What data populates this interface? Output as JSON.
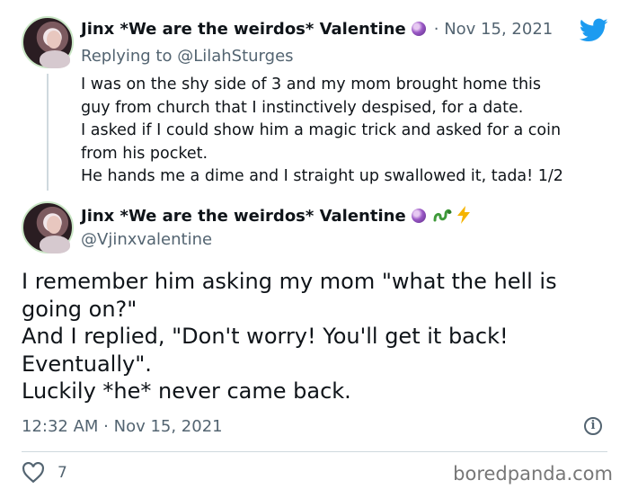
{
  "tweet1": {
    "name": "Jinx *We are the weirdos* Valentine",
    "date": "· Nov 15, 2021",
    "reply": "Replying to @LilahSturges",
    "lines": [
      "I was on the shy side of 3 and my mom brought home this",
      "guy from church that I instinctively despised, for a date.",
      "I asked if I could show him a magic trick and asked for a coin",
      "from his pocket.",
      "He hands me a dime and I straight up swallowed it, tada! 1/2"
    ]
  },
  "tweet2": {
    "name": "Jinx *We are the weirdos* Valentine",
    "handle": "@Vjinxvalentine",
    "lines": [
      "I remember him asking my mom \"what the hell is",
      "going on?\"",
      "And I replied, \"Don't worry! You'll get it back!",
      "Eventually\".",
      "Luckily *he* never came back."
    ],
    "timestamp": "12:32 AM · Nov 15, 2021",
    "likes": "7"
  },
  "watermark": "boredpanda.com",
  "colors": {
    "twitter_blue": "#1d9bf0",
    "muted": "#536471",
    "divider": "#cfd9de"
  },
  "icons": [
    "crystal-ball-icon",
    "twitter-bird-icon",
    "snake-icon",
    "lightning-icon",
    "info-icon",
    "heart-icon"
  ]
}
